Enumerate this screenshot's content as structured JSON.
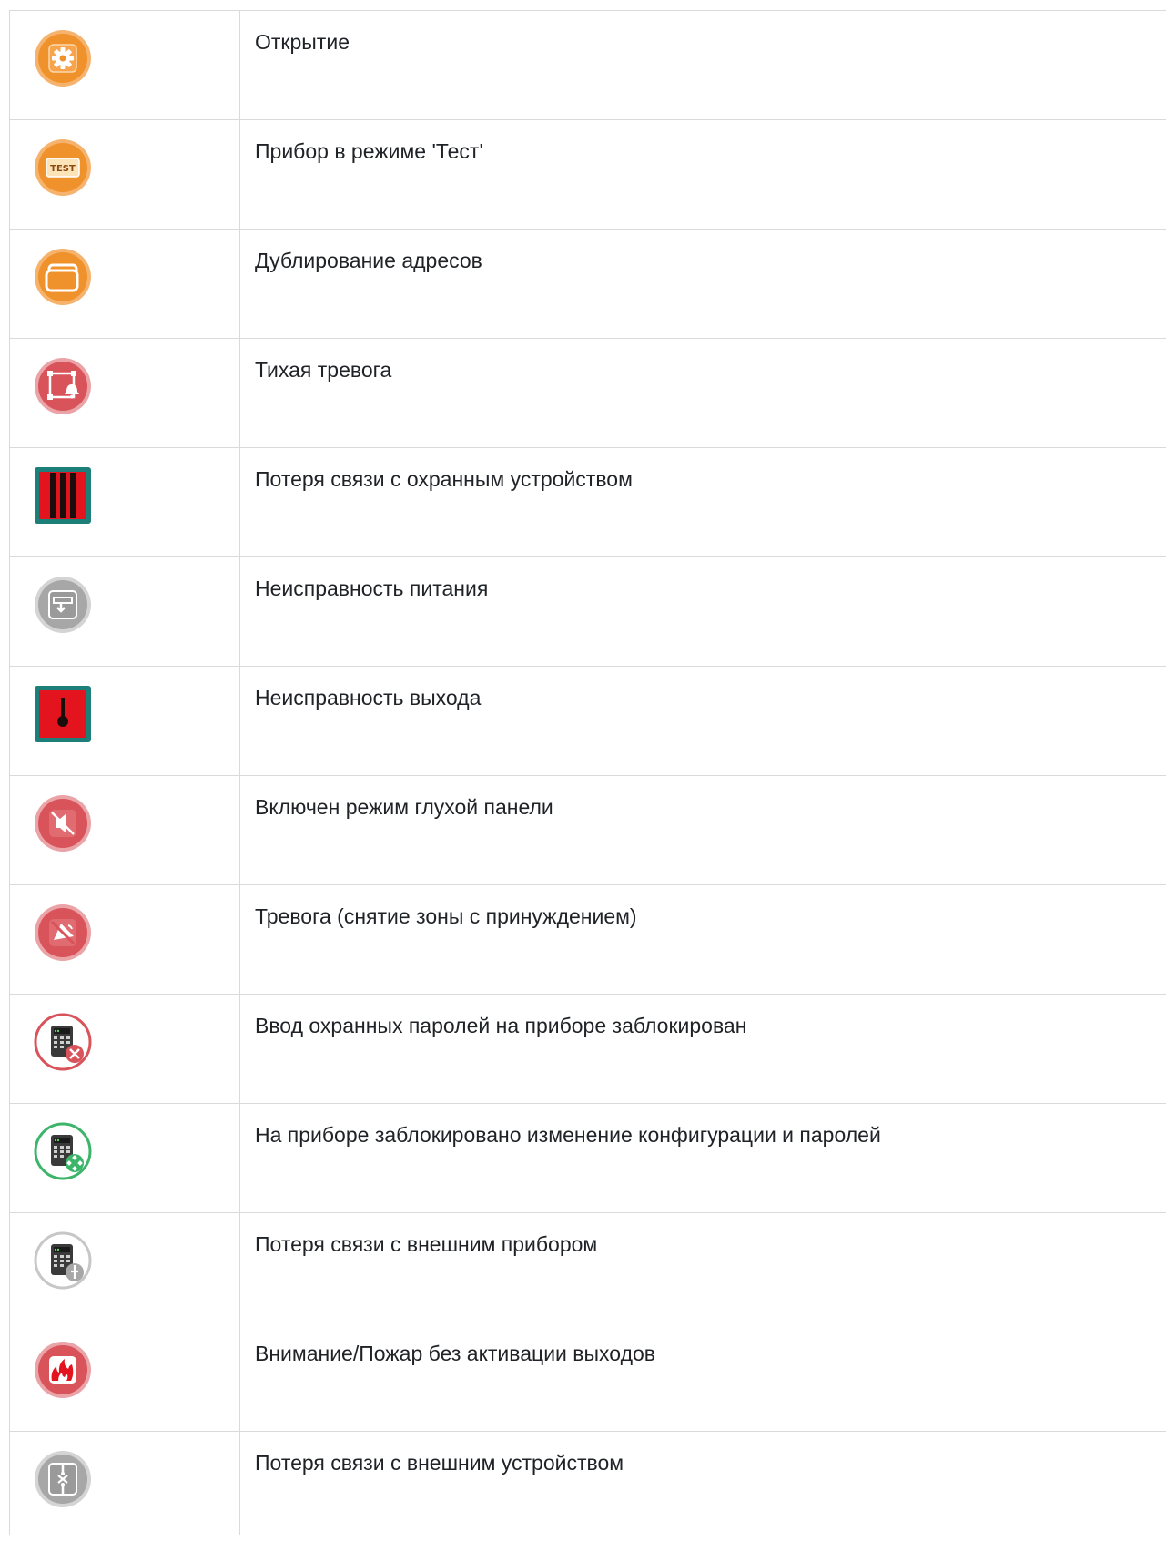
{
  "rows": [
    {
      "icon": "gear-icon",
      "label": "Открытие",
      "color": "#f0922b"
    },
    {
      "icon": "test-icon",
      "label": "Прибор в режиме 'Тест'",
      "color": "#f0922b",
      "icon_text": "TEST"
    },
    {
      "icon": "duplicate-icon",
      "label": "Дублирование адресов",
      "color": "#f0922b"
    },
    {
      "icon": "silent-alarm-icon",
      "label": "Тихая тревога",
      "color": "#d8535a"
    },
    {
      "icon": "guard-link-lost-icon",
      "label": "Потеря связи с охранным устройством",
      "color": "#e3141d"
    },
    {
      "icon": "power-fault-icon",
      "label": "Неисправность питания",
      "color": "#a7a7a7"
    },
    {
      "icon": "output-fault-icon",
      "label": "Неисправность выхода",
      "color": "#e3141d"
    },
    {
      "icon": "mute-panel-icon",
      "label": "Включен режим глухой панели",
      "color": "#d8535a"
    },
    {
      "icon": "duress-alarm-icon",
      "label": "Тревога (снятие зоны с принуждением)",
      "color": "#d8535a"
    },
    {
      "icon": "keypad-blocked-icon",
      "label": "Ввод охранных паролей на приборе заблокирован",
      "color": "#d8535a"
    },
    {
      "icon": "keypad-config-locked-icon",
      "label": "На приборе заблокировано изменение конфигурации и паролей",
      "color": "#3cb56a"
    },
    {
      "icon": "keypad-link-lost-icon",
      "label": "Потеря связи с внешним прибором",
      "color": "#a7a7a7"
    },
    {
      "icon": "fire-icon",
      "label": "Внимание/Пожар без активации выходов",
      "color": "#d8535a"
    },
    {
      "icon": "external-link-lost-icon",
      "label": "Потеря связи с внешним устройством",
      "color": "#a7a7a7"
    }
  ]
}
